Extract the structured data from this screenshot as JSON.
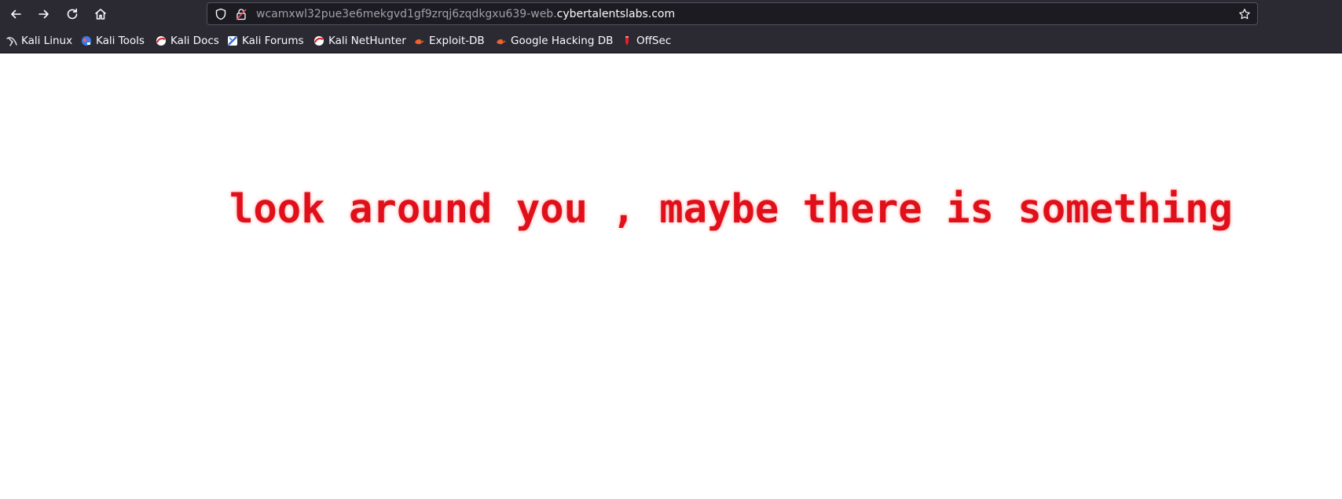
{
  "browser": {
    "url": {
      "subdomain": "wcamxwl32pue3e6mekgvd1gf9zrqj6zqdkgxu639-web.",
      "domain": "cybertalentslabs.com"
    },
    "nav": {
      "back_icon": "arrow-left-icon",
      "forward_icon": "arrow-right-icon",
      "reload_icon": "reload-icon",
      "home_icon": "home-icon"
    },
    "bookmarks": [
      {
        "label": "Kali Linux",
        "icon": "kali-dragon-icon"
      },
      {
        "label": "Kali Tools",
        "icon": "kali-tools-icon"
      },
      {
        "label": "Kali Docs",
        "icon": "kali-docs-icon"
      },
      {
        "label": "Kali Forums",
        "icon": "kali-forums-icon"
      },
      {
        "label": "Kali NetHunter",
        "icon": "kali-nethunter-icon"
      },
      {
        "label": "Exploit-DB",
        "icon": "exploit-db-icon"
      },
      {
        "label": "Google Hacking DB",
        "icon": "ghdb-icon"
      },
      {
        "label": "OffSec",
        "icon": "offsec-icon"
      }
    ],
    "colors": {
      "chrome": "#2b2a33",
      "urlbar": "#1c1b22",
      "text": "#fbfbfe"
    }
  },
  "page": {
    "message": "look around you , maybe there is something",
    "message_color": "#e0101b",
    "background": "#ffffff"
  }
}
